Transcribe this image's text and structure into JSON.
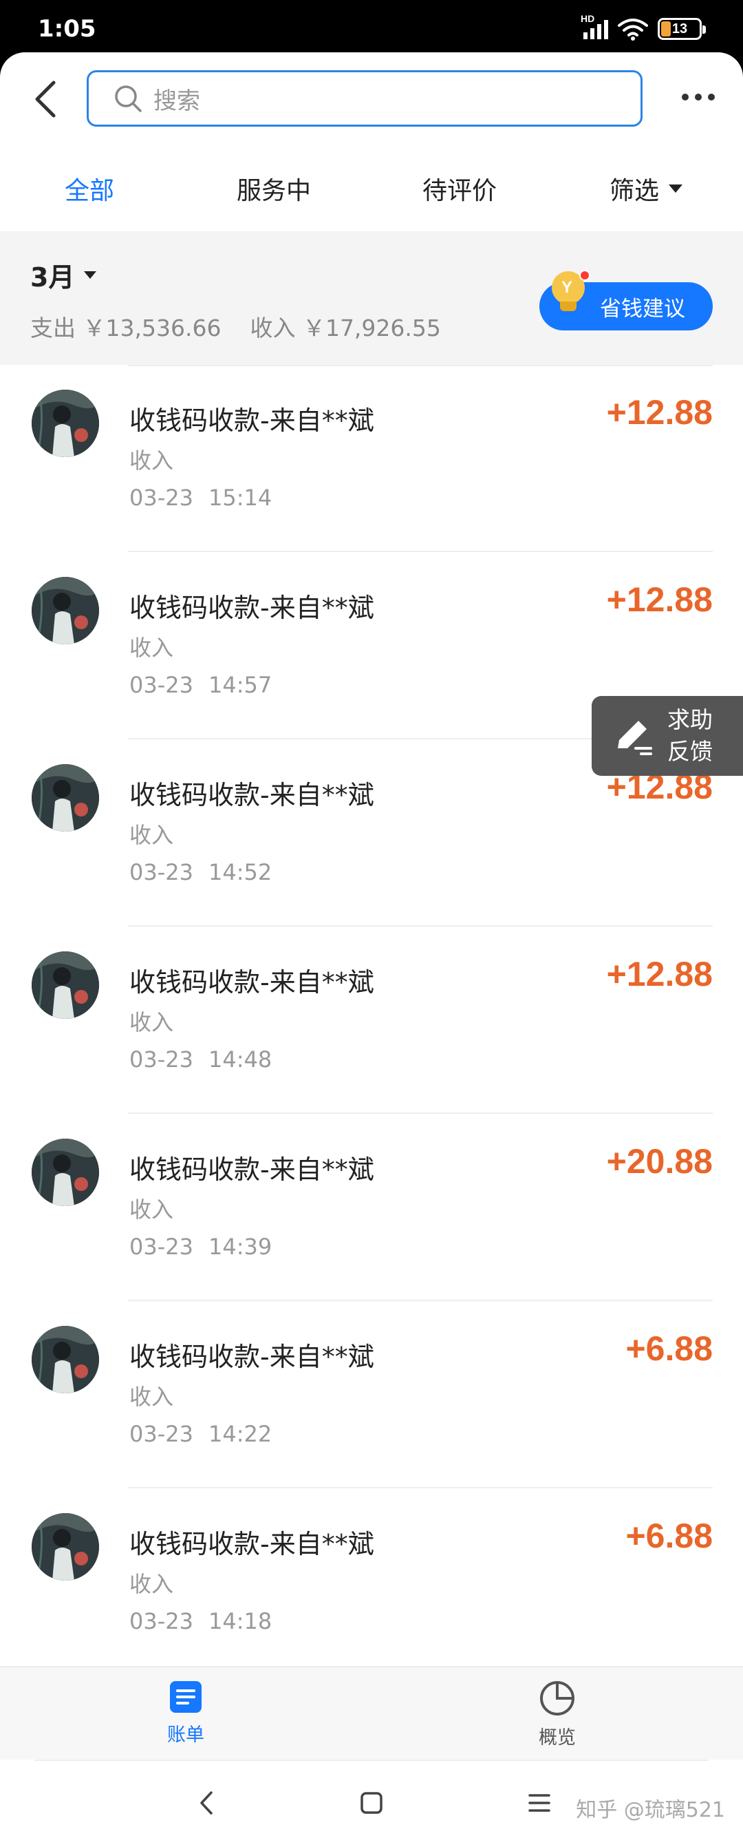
{
  "status_bar": {
    "time": "1:05",
    "network": "HD",
    "battery": "13"
  },
  "search": {
    "placeholder": "搜索"
  },
  "tabs": [
    {
      "label": "全部",
      "active": true
    },
    {
      "label": "服务中",
      "active": false
    },
    {
      "label": "待评价",
      "active": false
    },
    {
      "label": "筛选",
      "active": false
    }
  ],
  "summary": {
    "month": "3月",
    "expense": "支出 ￥13,536.66",
    "income": "收入 ￥17,926.55",
    "advice_button": "省钱建议"
  },
  "transactions": [
    {
      "title": "收钱码收款-来自**斌",
      "type": "收入",
      "date": "03-23",
      "time": "15:14",
      "amount": "+12.88"
    },
    {
      "title": "收钱码收款-来自**斌",
      "type": "收入",
      "date": "03-23",
      "time": "14:57",
      "amount": "+12.88"
    },
    {
      "title": "收钱码收款-来自**斌",
      "type": "收入",
      "date": "03-23",
      "time": "14:52",
      "amount": "+12.88"
    },
    {
      "title": "收钱码收款-来自**斌",
      "type": "收入",
      "date": "03-23",
      "time": "14:48",
      "amount": "+12.88"
    },
    {
      "title": "收钱码收款-来自**斌",
      "type": "收入",
      "date": "03-23",
      "time": "14:39",
      "amount": "+20.88"
    },
    {
      "title": "收钱码收款-来自**斌",
      "type": "收入",
      "date": "03-23",
      "time": "14:22",
      "amount": "+6.88"
    },
    {
      "title": "收钱码收款-来自**斌",
      "type": "收入",
      "date": "03-23",
      "time": "14:18",
      "amount": "+6.88"
    }
  ],
  "help_float": {
    "line1": "求助",
    "line2": "反馈"
  },
  "bottom_nav": [
    {
      "label": "账单",
      "icon": "bill-icon",
      "active": true
    },
    {
      "label": "概览",
      "icon": "pie-chart-icon",
      "active": false
    }
  ],
  "watermark": "知乎 @琉璃521",
  "colors": {
    "accent": "#1677ff",
    "amount": "#e8662a",
    "search_border": "#2b84e6"
  }
}
